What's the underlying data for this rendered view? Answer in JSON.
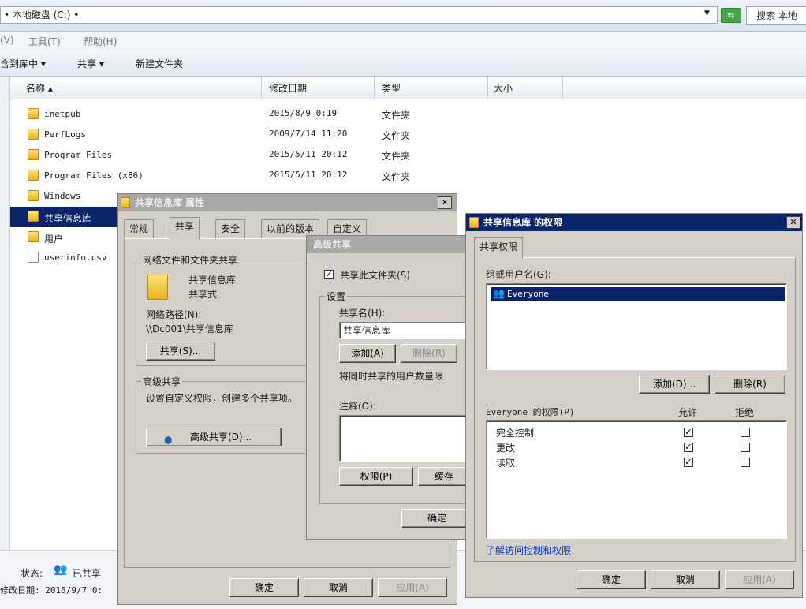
{
  "explorer": {
    "address": "• 本地磁盘 (C:) •",
    "search_label": "搜索 本地",
    "menu": [
      "(V)",
      "工具(T)",
      "帮助(H)"
    ],
    "toolbar": [
      "含到库中 ▾",
      "共享 ▾",
      "新建文件夹"
    ],
    "columns": [
      "名称 ▴",
      "修改日期",
      "类型",
      "大小"
    ],
    "files": [
      {
        "name": "inetpub",
        "date": "2015/8/9 0:19",
        "type": "文件夹",
        "icon": "folder-icon"
      },
      {
        "name": "PerfLogs",
        "date": "2009/7/14 11:20",
        "type": "文件夹",
        "icon": "folder-icon"
      },
      {
        "name": "Program Files",
        "date": "2015/5/11 20:12",
        "type": "文件夹",
        "icon": "folder-icon"
      },
      {
        "name": "Program Files (x86)",
        "date": "2015/5/11 20:12",
        "type": "文件夹",
        "icon": "folder-icon"
      },
      {
        "name": "Windows",
        "date": "",
        "type": "",
        "icon": "folder-icon"
      },
      {
        "name": "共享信息库",
        "date": "",
        "type": "",
        "icon": "folder-icon",
        "selected": true
      },
      {
        "name": "用户",
        "date": "",
        "type": "",
        "icon": "folder-icon"
      },
      {
        "name": "userinfo.csv",
        "date": "",
        "type": "",
        "icon": "file-icon"
      }
    ],
    "status_label": "状态:",
    "status_value": "已共享",
    "modified": "修改日期: 2015/9/7 0:"
  },
  "props": {
    "title": "共享信息库 属性",
    "tabs": [
      "常规",
      "共享",
      "安全",
      "以前的版本",
      "自定义"
    ],
    "net_group": "网络文件和文件夹共享",
    "folder_name": "共享信息库",
    "share_type": "共享式",
    "net_path_label": "网络路径(N):",
    "net_path": "\\\\Dc001\\共享信息库",
    "share_btn": "共享(S)...",
    "adv_group": "高级共享",
    "adv_desc": "设置自定义权限，创建多个共享项。",
    "adv_btn": "高级共享(D)...",
    "ok": "确定",
    "cancel": "取消",
    "apply": "应用(A)"
  },
  "adv": {
    "title": "高级共享",
    "share_check": "共享此文件夹(S)",
    "settings": "设置",
    "name_label": "共享名(H):",
    "name_value": "共享信息库",
    "add": "添加(A)",
    "remove": "删除(R)",
    "limit": "将同时共享的用户数量限",
    "comment": "注释(O):",
    "perm_btn": "权限(P)",
    "cache_btn": "缓存",
    "ok": "确定"
  },
  "perm": {
    "title": "共享信息库 的权限",
    "tab": "共享权限",
    "group_label": "组或用户名(G):",
    "users": [
      "Everyone"
    ],
    "add": "添加(D)...",
    "remove": "删除(R)",
    "perm_label": "Everyone 的权限(P)",
    "allow": "允许",
    "deny": "拒绝",
    "rows": [
      {
        "name": "完全控制",
        "allow": true,
        "deny": false
      },
      {
        "name": "更改",
        "allow": true,
        "deny": false
      },
      {
        "name": "读取",
        "allow": true,
        "deny": false
      }
    ],
    "link": "了解访问控制和权限",
    "ok": "确定",
    "cancel": "取消",
    "apply": "应用(A)"
  }
}
